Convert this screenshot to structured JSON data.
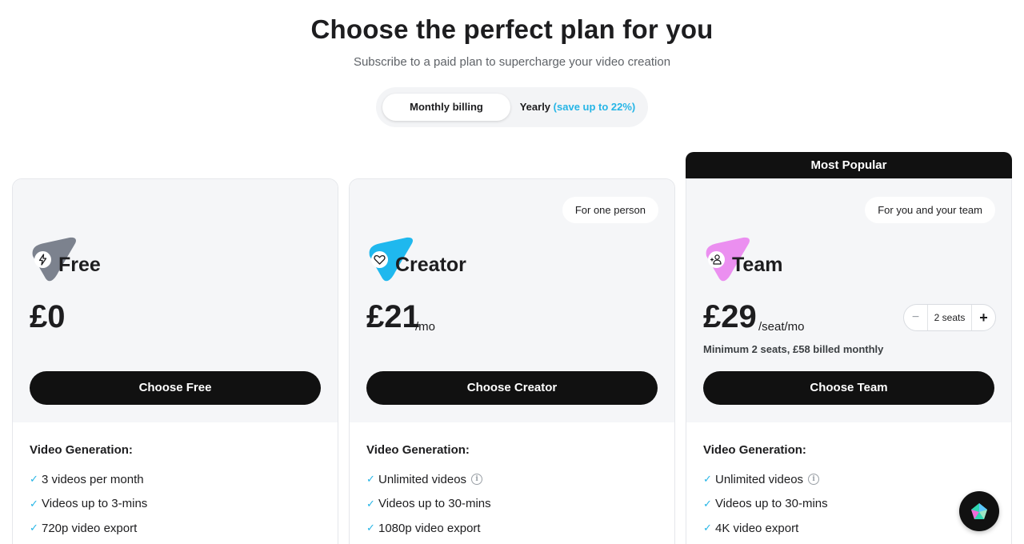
{
  "header": {
    "title": "Choose the perfect plan for you",
    "subtitle": "Subscribe to a paid plan to supercharge your video creation"
  },
  "billing_toggle": {
    "monthly_label": "Monthly billing",
    "yearly_label": "Yearly",
    "yearly_save": "(save up to 22%)",
    "selected": "Monthly billing"
  },
  "plans": [
    {
      "name": "Free",
      "pill": "",
      "price": "£0",
      "per": "",
      "note": "",
      "cta": "Choose Free",
      "logo_color": "#7c828e",
      "icon": "bolt-icon",
      "section_title": "Video Generation:",
      "features": [
        "3 videos per month",
        "Videos up to 3-mins",
        "720p video export"
      ]
    },
    {
      "name": "Creator",
      "pill": "For one person",
      "price": "£21",
      "per": "/mo",
      "note": "",
      "cta": "Choose Creator",
      "logo_color": "#1fb8ee",
      "icon": "heart-icon",
      "section_title": "Video Generation:",
      "features": [
        "Unlimited videos",
        "Videos up to 30-mins",
        "1080p video export"
      ]
    },
    {
      "name": "Team",
      "pill": "For you and your team",
      "badge": "Most Popular",
      "price": "£29",
      "per": "/seat/mo",
      "note": "Minimum 2 seats, £58 billed monthly",
      "seats": "2 seats",
      "seats_minus": "−",
      "seats_plus": "+",
      "cta": "Choose Team",
      "logo_color": "#eb8ff0",
      "icon": "add-user-icon",
      "section_title": "Video Generation:",
      "features": [
        "Unlimited videos",
        "Videos up to 30-mins",
        "4K video export"
      ]
    }
  ],
  "feature_check": "✓",
  "info_glyph": "i",
  "chat_button": {
    "icon": "chat-logo-icon"
  }
}
